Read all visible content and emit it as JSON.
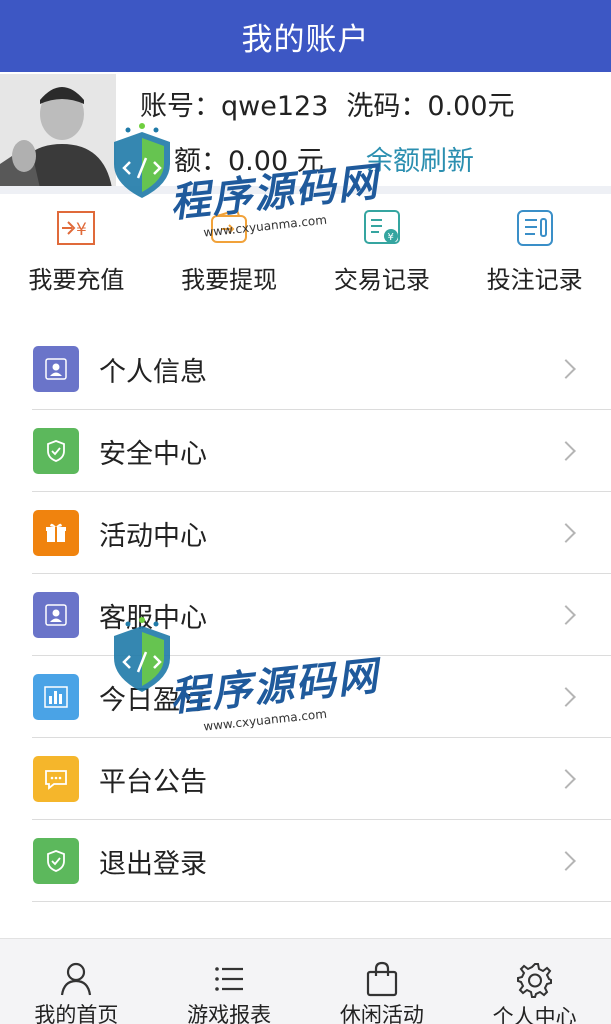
{
  "header": {
    "title": "我的账户"
  },
  "account": {
    "account_label": "账号：",
    "account_value": "qwe123",
    "wash_label": "洗码：",
    "wash_value": "0.00元",
    "balance_label": "额：",
    "balance_value": "0.00 元",
    "refresh_label": "余额刷新"
  },
  "quick_actions": [
    {
      "label": "我要充值",
      "icon": "recharge-icon"
    },
    {
      "label": "我要提现",
      "icon": "wallet-icon"
    },
    {
      "label": "交易记录",
      "icon": "transaction-record-icon"
    },
    {
      "label": "投注记录",
      "icon": "bet-record-icon"
    }
  ],
  "menu": [
    {
      "label": "个人信息",
      "icon": "user-icon",
      "color": "#6a74c9"
    },
    {
      "label": "安全中心",
      "icon": "shield-icon",
      "color": "#5cb85c"
    },
    {
      "label": "活动中心",
      "icon": "gift-icon",
      "color": "#f0830e"
    },
    {
      "label": "客服中心",
      "icon": "user-icon",
      "color": "#6a74c9"
    },
    {
      "label": "今日盈亏",
      "icon": "bar-chart-icon",
      "color": "#4aa3e6"
    },
    {
      "label": "平台公告",
      "icon": "message-icon",
      "color": "#f5b62b"
    },
    {
      "label": "退出登录",
      "icon": "shield-icon",
      "color": "#5cb85c"
    }
  ],
  "tabbar": [
    {
      "label": "我的首页",
      "icon": "person-icon"
    },
    {
      "label": "游戏报表",
      "icon": "list-icon"
    },
    {
      "label": "休闲活动",
      "icon": "bag-icon"
    },
    {
      "label": "个人中心",
      "icon": "gear-icon"
    }
  ],
  "watermark": {
    "text": "程序源码网",
    "url": "www.cxyuanma.com"
  },
  "colors": {
    "primary": "#3d57c4",
    "refresh": "#2b8fb0",
    "tabbar_bg": "#f4f4f6"
  }
}
